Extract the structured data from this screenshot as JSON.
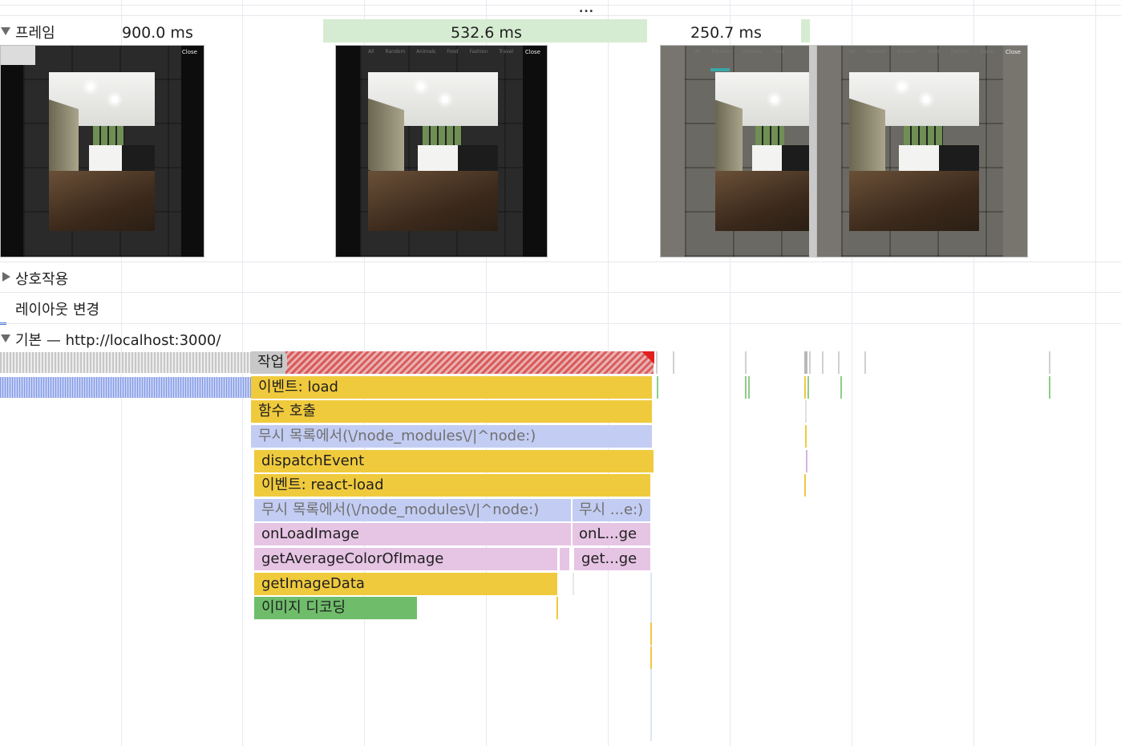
{
  "toolbar": {
    "more_label": "..."
  },
  "tracks": {
    "frames": {
      "label": "프레임"
    },
    "interactions": {
      "label": "상호작용"
    },
    "layout_shifts": {
      "label": "레이아웃 변경"
    },
    "main": {
      "label": "기본 — http://localhost:3000/"
    }
  },
  "frames": {
    "durations": [
      {
        "label": "900.0 ms"
      },
      {
        "label": "532.6 ms"
      },
      {
        "label": "250.7 ms"
      }
    ],
    "screenshot_tabs": [
      "All",
      "Random",
      "Animals",
      "Food",
      "Fashion",
      "Travel"
    ],
    "screenshot_close": "Close"
  },
  "flame": {
    "task": "작업",
    "event_load": "이벤트: load",
    "function_call": "함수 호출",
    "ignore_list": "무시 목록에서(\\/node_modules\\/|^node:)",
    "dispatch": "dispatchEvent",
    "react_load": "이벤트: react-load",
    "ignore_list_2": "무시 목록에서(\\/node_modules\\/|^node:)",
    "ignore_list_short": "무시 ...e:)",
    "on_load_image": "onLoadImage",
    "on_load_image_short": "onL...ge",
    "get_avg": "getAverageColorOfImage",
    "get_avg_short": "get...ge",
    "get_image_data": "getImageData",
    "image_decode": "이미지 디코딩"
  },
  "colors": {
    "scripting": "#f0ca3d",
    "ignored": "#c3cdf3",
    "js_function": "#e6c4e4",
    "painting": "#6fbd6b",
    "long_task": "#d95b5b",
    "frame_bar": "#d6ecd2"
  }
}
